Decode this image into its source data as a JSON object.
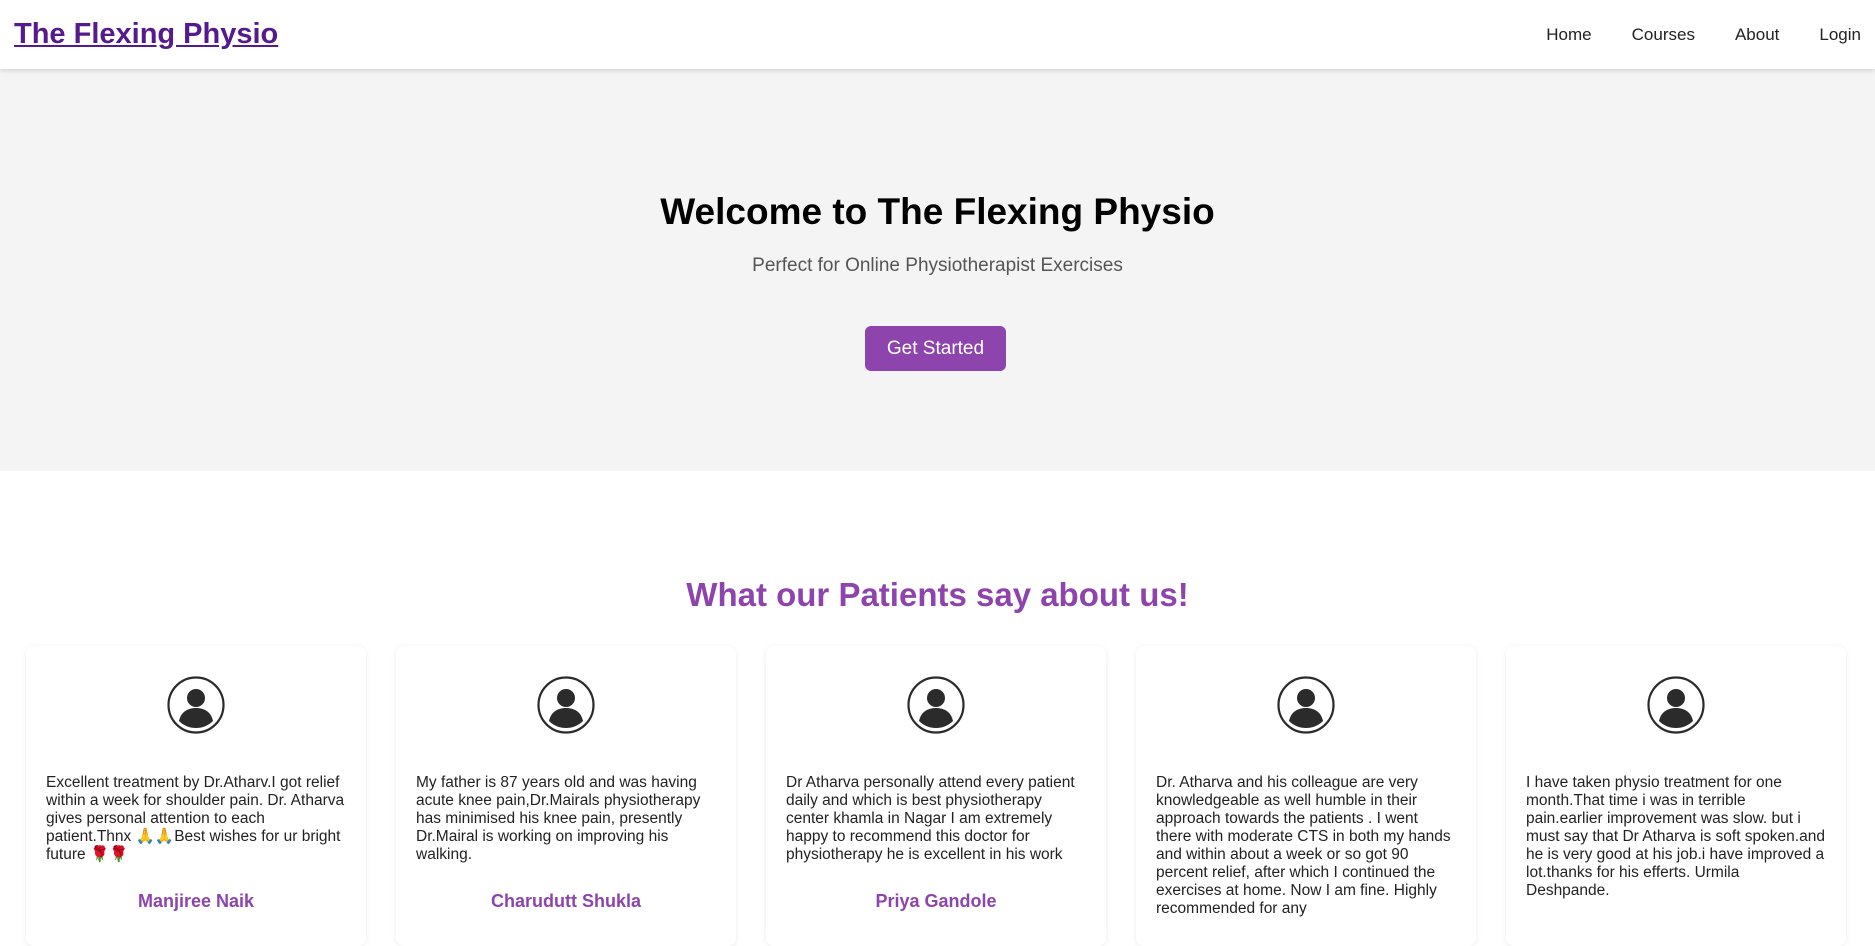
{
  "nav": {
    "brand": "The Flexing Physio",
    "links": [
      "Home",
      "Courses",
      "About",
      "Login"
    ]
  },
  "hero": {
    "title": "Welcome to The Flexing Physio",
    "subtitle": "Perfect for Online Physiotherapist Exercises",
    "cta_label": "Get Started"
  },
  "testimonials": {
    "heading": "What our Patients say about us!",
    "items": [
      {
        "text": "Excellent treatment by Dr.Atharv.I got relief within a week for shoulder pain. Dr. Atharva gives personal attention to each patient.Thnx 🙏🙏Best wishes for ur bright future 🌹🌹",
        "author": "Manjiree Naik"
      },
      {
        "text": "My father is 87 years old and was having acute knee pain,Dr.Mairals physiotherapy has minimised his knee pain, presently Dr.Mairal is working on improving his walking.",
        "author": "Charudutt Shukla"
      },
      {
        "text": "Dr Atharva personally attend every patient daily and which is best physiotherapy center khamla in Nagar I am extremely happy to recommend this doctor for physiotherapy he is excellent in his work",
        "author": "Priya Gandole"
      },
      {
        "text": "Dr. Atharva and his colleague are very knowledgeable as well humble in their approach towards the patients . I went there with moderate CTS in both my hands and within about a week or so got 90 percent relief, after which I continued the exercises at home. Now I am fine. Highly recommended for any",
        "author": ""
      },
      {
        "text": "I have taken physio treatment for one month.That time i was in terrible pain.earlier improvement was slow. but i must say that Dr Atharva is soft spoken.and he is very good at his job.i have improved a lot.thanks for his efferts. Urmila Deshpande.",
        "author": ""
      }
    ]
  },
  "colors": {
    "accent": "#8e44ad",
    "brand_link": "#551a8b",
    "hero_bg": "#f4f4f4"
  },
  "icons": {
    "avatar": "user-circle-icon"
  }
}
